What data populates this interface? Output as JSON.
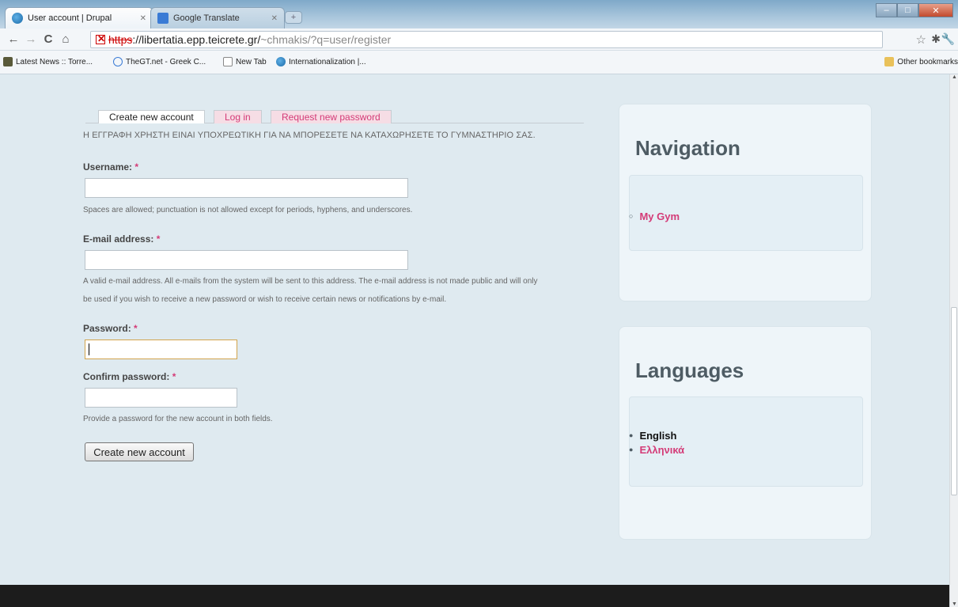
{
  "browser": {
    "tabs": [
      {
        "label": "User account | Drupal",
        "active": true,
        "icon": "drupal-icon"
      },
      {
        "label": "Google Translate",
        "active": false,
        "icon": "google-translate-icon"
      }
    ],
    "address": {
      "scheme": "https",
      "host": "://libertatia.epp.teicrete.gr/",
      "path": "~chmakis/?q=user/register"
    },
    "bookmarks": [
      {
        "label": "Latest News :: Torre...",
        "icon": "news-icon"
      },
      {
        "label": "TheGT.net - Greek C...",
        "icon": "globe-icon"
      },
      {
        "label": "New Tab",
        "icon": "page-icon"
      },
      {
        "label": "Internationalization |...",
        "icon": "drupal-icon"
      }
    ],
    "other_bookmarks": "Other bookmarks"
  },
  "user_tabs": {
    "create": "Create new account",
    "login": "Log in",
    "request": "Request new password"
  },
  "intro": "Η ΕΓΓΡΑΦΗ ΧΡΗΣΤΗ ΕΙΝΑΙ ΥΠΟΧΡΕΩΤΙΚΗ ΓΙΑ ΝΑ ΜΠΟΡΕΣΕΤΕ ΝΑ ΚΑΤΑΧΩΡΗΣΕΤΕ ΤΟ ΓΥΜΝΑΣΤΗΡΙΟ ΣΑΣ.",
  "form": {
    "username_label": "Username:",
    "username_desc": "Spaces are allowed; punctuation is not allowed except for periods, hyphens, and underscores.",
    "email_label": "E-mail address:",
    "email_desc_1": "A valid e-mail address. All e-mails from the system will be sent to this address. The e-mail address is not made public and will only",
    "email_desc_2": "be used if you wish to receive a new password or wish to receive certain news or notifications by e-mail.",
    "password_label": "Password:",
    "confirm_label": "Confirm password:",
    "password_desc": "Provide a password for the new account in both fields.",
    "required_mark": "*",
    "submit": "Create new account"
  },
  "navigation_block": {
    "title": "Navigation",
    "items": [
      "My Gym"
    ]
  },
  "languages_block": {
    "title": "Languages",
    "items": [
      "English",
      "Ελληνικά"
    ]
  },
  "colors": {
    "link": "#d43b77",
    "page_bg": "#dfeaf0",
    "footer": "#1c1c1c"
  }
}
